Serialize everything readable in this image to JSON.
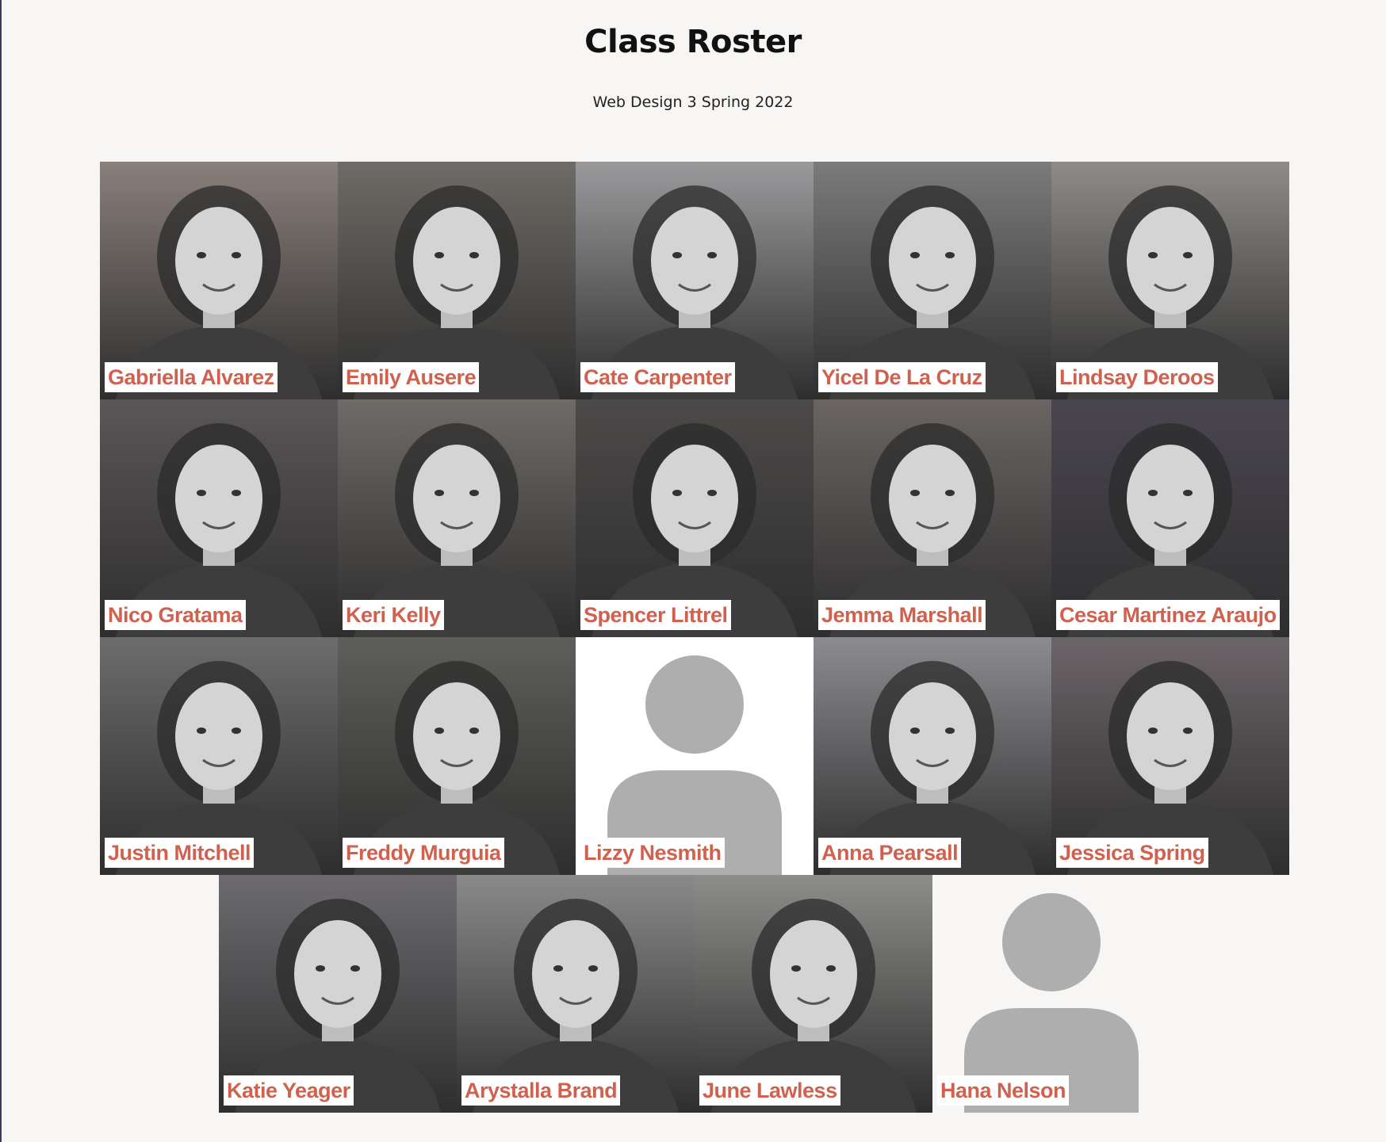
{
  "page": {
    "title": "Class Roster",
    "subtitle": "Web Design 3 Spring 2022"
  },
  "students": [
    {
      "name": "Gabriella Alvarez",
      "photo": "portrait-photo",
      "tone": "#8a7f7a"
    },
    {
      "name": "Emily Ausere",
      "photo": "portrait-photo",
      "tone": "#6f6b66"
    },
    {
      "name": "Cate Carpenter",
      "photo": "portrait-photo",
      "tone": "#9a9a9c"
    },
    {
      "name": "Yicel De La Cruz",
      "photo": "portrait-photo",
      "tone": "#7b7b7b"
    },
    {
      "name": "Lindsay Deroos",
      "photo": "portrait-photo",
      "tone": "#8e8b88"
    },
    {
      "name": "Nico Gratama",
      "photo": "portrait-photo",
      "tone": "#5b5658"
    },
    {
      "name": "Keri Kelly",
      "photo": "portrait-photo",
      "tone": "#6e6a67"
    },
    {
      "name": "Spencer Littrel",
      "photo": "portrait-photo",
      "tone": "#4c4a49"
    },
    {
      "name": "Jemma Marshall",
      "photo": "portrait-photo",
      "tone": "#6a6563"
    },
    {
      "name": "Cesar Martinez Araujo",
      "photo": "portrait-photo",
      "tone": "#4a4650"
    },
    {
      "name": "Justin Mitchell",
      "photo": "portrait-photo",
      "tone": "#6c6c6c"
    },
    {
      "name": "Freddy Murguia",
      "photo": "portrait-photo",
      "tone": "#5e5e5a"
    },
    {
      "name": "Lizzy Nesmith",
      "photo": "default-avatar-icon",
      "tone": "#ffffff"
    },
    {
      "name": "Anna Pearsall",
      "photo": "portrait-photo",
      "tone": "#8c8c90"
    },
    {
      "name": "Jessica Spring",
      "photo": "portrait-photo",
      "tone": "#6b6468"
    },
    {
      "name": "Katie Yeager",
      "photo": "portrait-photo",
      "tone": "#6d6b6f"
    },
    {
      "name": "Arystalla Brand",
      "photo": "portrait-photo",
      "tone": "#8a8a8a"
    },
    {
      "name": "June Lawless",
      "photo": "portrait-photo",
      "tone": "#8d8d8b"
    },
    {
      "name": "Hana Nelson",
      "photo": "default-avatar-icon",
      "tone": "#f7f6f4"
    }
  ],
  "colors": {
    "name_text": "#d0614f",
    "name_background": "#ffffff",
    "page_background": "#f7f6f4",
    "avatar_gray": "#aeaeae"
  }
}
